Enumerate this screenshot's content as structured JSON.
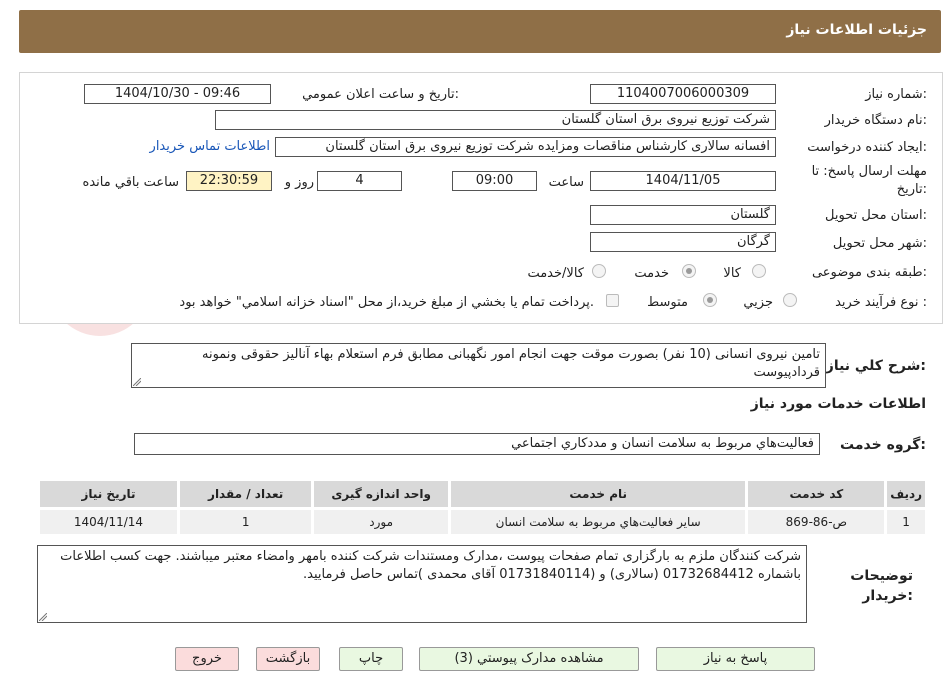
{
  "header": {
    "title": "جزئیات اطلاعات نیاز"
  },
  "form": {
    "need_number_label": "شماره نياز:",
    "need_number": "1104007006000309",
    "announce_label": "تاریخ و ساعت اعلان عمومي:",
    "announce_value": "1404/10/30 - 09:46",
    "buyer_org_label": "نام دستگاه خريدار:",
    "buyer_org": "شرکت توزیع نیروی برق استان گلستان",
    "creator_label": "ايجاد كننده درخواست:",
    "creator": "افسانه سالاری کارشناس مناقصات ومزایده شرکت توزیع نیروی برق استان گلستان",
    "buyer_contact_link": "اطلاعات تماس خريدار",
    "deadline_label_line1": "مهلت ارسال پاسخ: تا",
    "deadline_label_line2": "تاريخ:",
    "deadline_date": "1404/11/05",
    "deadline_time_label": "ساعت",
    "deadline_time": "09:00",
    "days_value": "4",
    "days_label": "روز و",
    "remaining_time": "22:30:59",
    "remaining_label": "ساعت باقي مانده",
    "province_label": "استان محل تحويل:",
    "province": "گلستان",
    "city_label": "شهر محل تحويل:",
    "city": "گرگان",
    "category_label": "طبقه بندی موضوعی:",
    "category_options": [
      "كالا",
      "خدمت",
      "كالا/خدمت"
    ],
    "category_selected": "خدمت",
    "process_label": "نوع فرآيند خريد :",
    "process_options": [
      "جزيي",
      "متوسط"
    ],
    "process_selected": "متوسط",
    "payment_note": "پرداخت تمام يا بخشي از مبلغ خريد،از محل \"اسناد خزانه اسلامي\" خواهد بود."
  },
  "description": {
    "label": "شرح كلي نياز:",
    "text": "تامین نیروی انسانی (10 نفر) بصورت موقت جهت انجام امور نگهبانی مطابق فرم استعلام بهاء آنالیز حقوقی ونمونه قردادپیوست"
  },
  "services": {
    "section_title": "اطلاعات خدمات مورد نياز",
    "group_label": "گروه خدمت:",
    "group_value": "فعاليت‌هاي مربوط به سلامت انسان و مددكاري اجتماعي",
    "columns": [
      "رديف",
      "كد خدمت",
      "نام خدمت",
      "واحد اندازه گيری",
      "تعداد / مقدار",
      "تاريخ نياز"
    ],
    "rows": [
      [
        "1",
        "ص-86-869",
        "ساير فعاليت‌هاي مربوط به سلامت انسان",
        "مورد",
        "1",
        "1404/11/14"
      ]
    ]
  },
  "buyer_notes": {
    "label_line1": "توضيحات",
    "label_line2": "خريدار:",
    "text": "شرکت کنندگان ملزم به بارگزاری تمام صفحات پیوست ،مدارک ومستندات شرکت کننده بامهر وامضاء معتبر میباشند. جهت کسب اطلاعات باشماره 01732684412 (سالاری) و  (01731840114 آقای محمدی )تماس حاصل فرمایید."
  },
  "buttons": {
    "reply": "پاسخ به نياز",
    "attachments": "مشاهده مدارک پيوستي (3)",
    "print": "چاپ",
    "back": "بازگشت",
    "exit": "خروج"
  },
  "colors": {
    "header": "#8f6f47",
    "link": "#1a57b8",
    "remaining_bg": "#fff3c4",
    "button_green": "#e9f8e1",
    "button_pink": "#fbdcdc"
  }
}
